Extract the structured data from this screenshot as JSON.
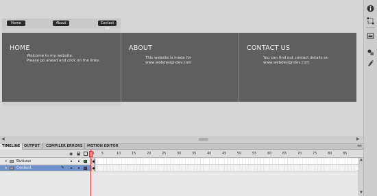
{
  "stage": {
    "nav_buttons": [
      "Home",
      "About",
      "Contact Us"
    ],
    "panels": [
      {
        "title": "HOME",
        "text": "Welcome to my website.\nPlease go ahead and click on the links."
      },
      {
        "title": "ABOUT",
        "text": "This website is made for\nwww.webdesigndev.com"
      },
      {
        "title": "CONTACT US",
        "text": "You can find out contact details on\nwww.webdesigndev.com"
      }
    ],
    "panel_bg": "#5f5f5f",
    "stage_bg": "#d6d6d6"
  },
  "timeline": {
    "tabs": [
      "TIMELINE",
      "OUTPUT",
      "COMPILER ERRORS",
      "MOTION EDITOR"
    ],
    "active_tab": "TIMELINE",
    "frame_numbers": [
      "1",
      "5",
      "10",
      "15",
      "20",
      "25",
      "30",
      "35",
      "40",
      "45",
      "50",
      "55",
      "60",
      "65",
      "70",
      "75",
      "80",
      "85"
    ],
    "layers": [
      {
        "name": "Buttons",
        "selected": false,
        "color": "#2f7a2f"
      },
      {
        "name": "Content",
        "selected": true,
        "color": "#5a2fb0"
      }
    ],
    "selection_color": "#6f8fc9",
    "playhead_color": "#d43232"
  },
  "icons": {
    "right_toolbar": [
      "info-icon",
      "transform-icon",
      "library-icon",
      "components-icon",
      "color-icon"
    ],
    "timeline_header": [
      "eye-icon",
      "lock-icon",
      "outline-icon"
    ]
  }
}
